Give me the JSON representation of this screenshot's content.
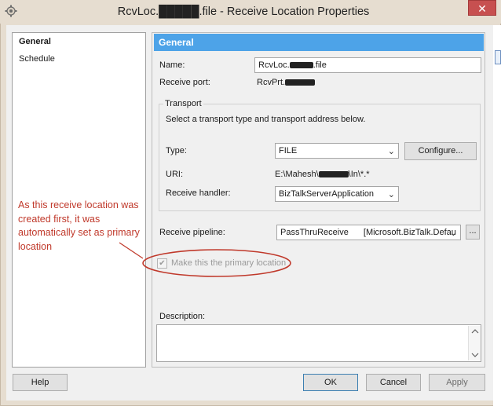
{
  "window": {
    "title": "RcvLoc.█████.file - Receive Location Properties",
    "close_glyph": "✕",
    "icon": "gear-icon"
  },
  "nav": {
    "items": [
      {
        "label": "General",
        "selected": true
      },
      {
        "label": "Schedule",
        "selected": false
      }
    ]
  },
  "section": {
    "header": "General"
  },
  "fields": {
    "name_label": "Name:",
    "name_value_prefix": "RcvLoc.",
    "name_value_suffix": ".file",
    "receive_port_label": "Receive port:",
    "receive_port_value_prefix": "RcvPrt."
  },
  "transport": {
    "legend": "Transport",
    "instruction": "Select a transport type and transport address below.",
    "type_label": "Type:",
    "type_value": "FILE",
    "configure_label": "Configure...",
    "uri_label": "URI:",
    "uri_prefix": "E:\\Mahesh\\",
    "uri_suffix": "\\In\\*.*",
    "handler_label": "Receive handler:",
    "handler_value": "BizTalkServerApplication"
  },
  "pipeline": {
    "label": "Receive pipeline:",
    "name": "PassThruReceive",
    "assembly": "[Microsoft.BizTalk.Defau",
    "browse_label": "..."
  },
  "primary": {
    "label": "Make this the primary location",
    "checked": true,
    "check_glyph": "✔"
  },
  "description": {
    "label": "Description:",
    "value": ""
  },
  "annotation": {
    "text": "As this receive location was created first, it was automatically set as primary location",
    "color": "#c0392b"
  },
  "buttons": {
    "help": "Help",
    "ok": "OK",
    "cancel": "Cancel",
    "apply": "Apply"
  },
  "colors": {
    "header_blue": "#4da3e8",
    "close_red": "#c75050",
    "frame": "#e6ddd0"
  }
}
